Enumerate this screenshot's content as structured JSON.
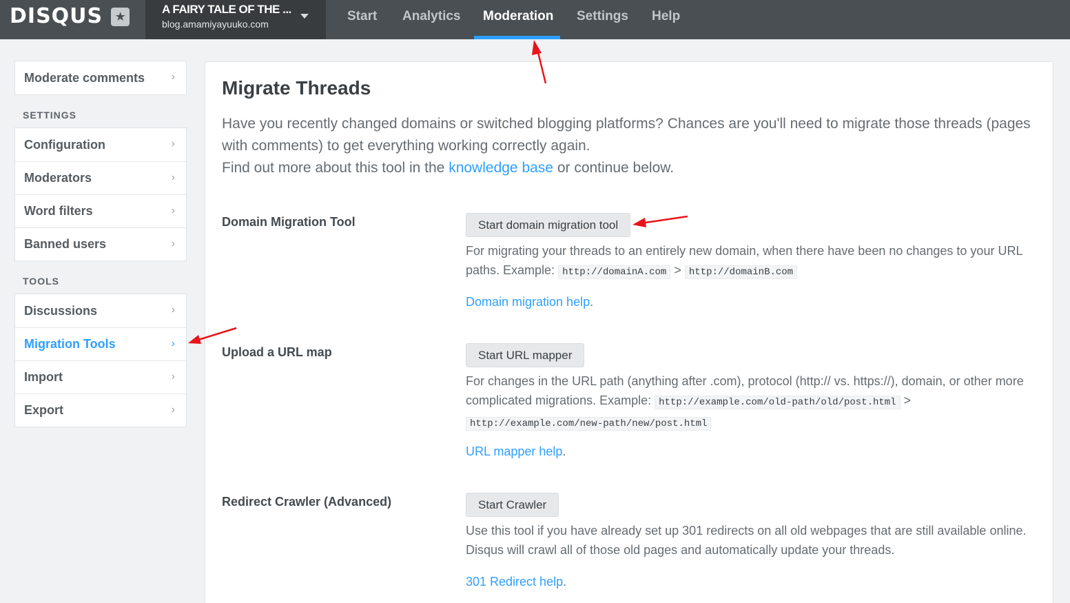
{
  "topbar": {
    "logo_text": "DISQUS",
    "logo_badge_icon": "star-icon",
    "site_name": "A FAIRY TALE OF THE ...",
    "site_url": "blog.amamiyayuuko.com",
    "tabs": [
      {
        "label": "Start"
      },
      {
        "label": "Analytics"
      },
      {
        "label": "Moderation",
        "active": true
      },
      {
        "label": "Settings"
      },
      {
        "label": "Help"
      }
    ],
    "accent_color": "#2e9fff"
  },
  "sidebar": {
    "top_item": "Moderate comments",
    "settings_heading": "SETTINGS",
    "settings_items": [
      "Configuration",
      "Moderators",
      "Word filters",
      "Banned users"
    ],
    "tools_heading": "TOOLS",
    "tools_items": [
      "Discussions",
      "Migration Tools",
      "Import",
      "Export"
    ],
    "active_item": "Migration Tools",
    "chevron": "›"
  },
  "main": {
    "title": "Migrate Threads",
    "intro_line1": "Have you recently changed domains or switched blogging platforms? Chances are you'll need to migrate those threads (pages with comments) to get everything working correctly again.",
    "intro_line2_before": "Find out more about this tool in the ",
    "intro_link": "knowledge base",
    "intro_line2_after": " or continue below.",
    "tools": [
      {
        "label": "Domain Migration Tool",
        "button": "Start domain migration tool",
        "desc_before": "For migrating your threads to an entirely new domain, when there have been no changes to your URL paths. Example: ",
        "code1": "http://domainA.com",
        "sep": ">",
        "code2": "http://domainB.com",
        "help": "Domain migration help",
        "help_dot": "."
      },
      {
        "label": "Upload a URL map",
        "button": "Start URL mapper",
        "desc_before": "For changes in the URL path (anything after .com), protocol (http:// vs. https://), domain, or other more complicated migrations. Example: ",
        "code1": "http://example.com/old-path/old/post.html",
        "sep": ">",
        "code2": "http://example.com/new-path/new/post.html",
        "help": "URL mapper help",
        "help_dot": "."
      },
      {
        "label": "Redirect Crawler (Advanced)",
        "button": "Start Crawler",
        "desc": "Use this tool if you have already set up 301 redirects on all old webpages that are still available online. Disqus will crawl all of those old pages and automatically update your threads.",
        "help": "301 Redirect help",
        "help_dot": "."
      }
    ]
  },
  "annotations": {
    "arrow_color": "#e8141a"
  }
}
